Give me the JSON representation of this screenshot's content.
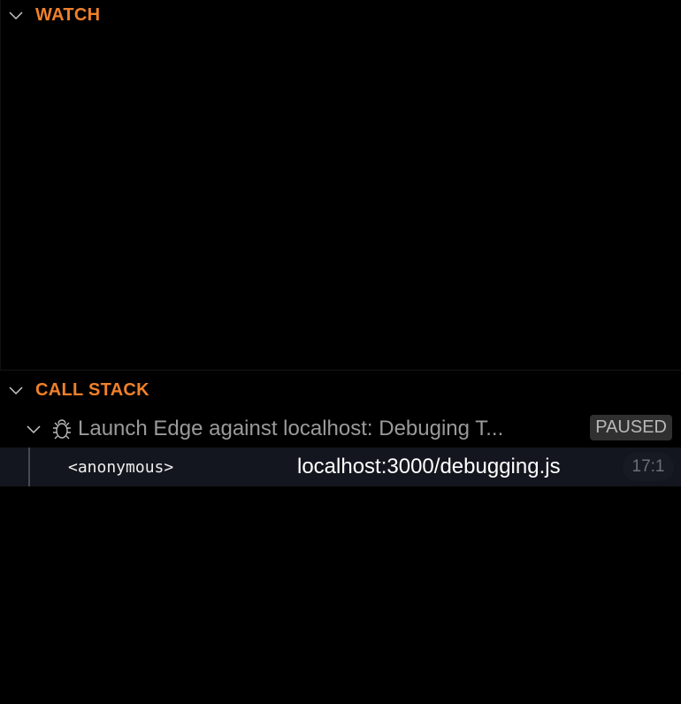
{
  "watch": {
    "title": "WATCH",
    "icon": "chevron-down-icon"
  },
  "call_stack": {
    "title": "CALL STACK",
    "session": {
      "name": "Launch Edge against localhost: Debuging T...",
      "status": "PAUSED",
      "icon": "bug-icon"
    },
    "frames": [
      {
        "function": "<anonymous>",
        "file": "localhost:3000/debugging.js",
        "position": "17:1"
      }
    ]
  },
  "colors": {
    "accent": "#f0802a",
    "background": "#000000",
    "selected_row": "#13161e"
  }
}
